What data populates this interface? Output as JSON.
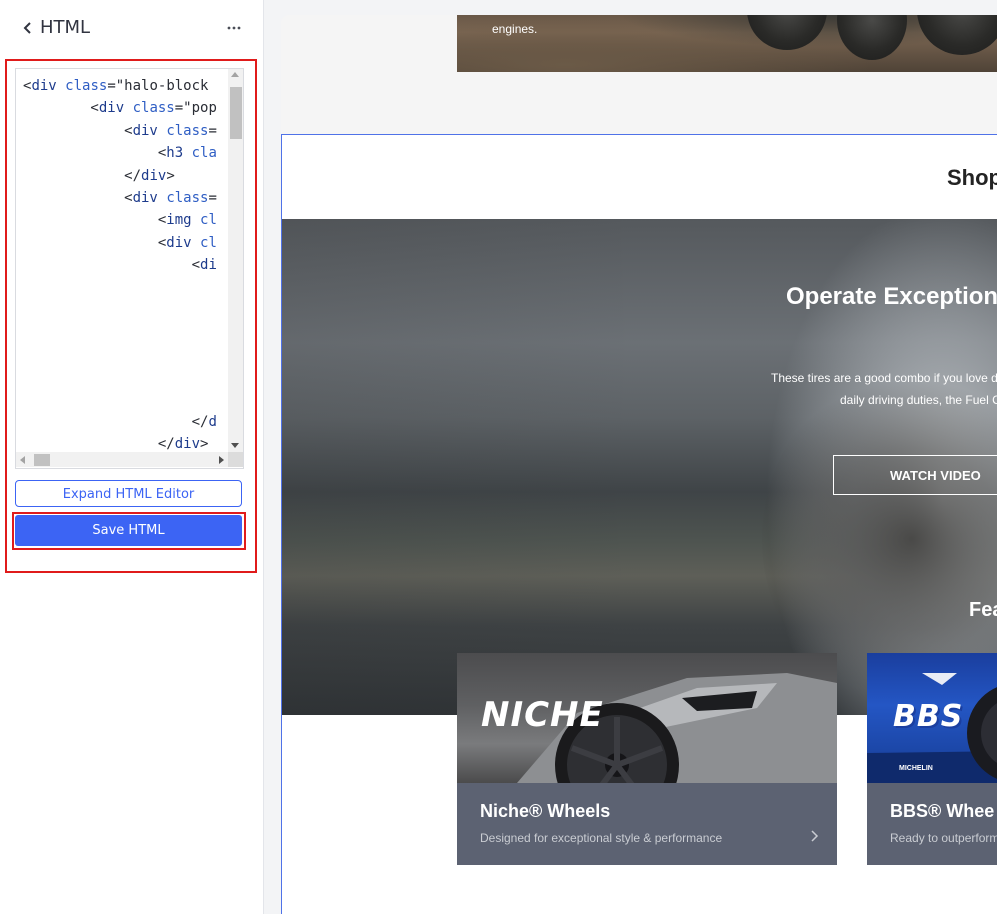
{
  "sidebar": {
    "title": "HTML",
    "code_lines": [
      "<div class=\"halo-block",
      "        <div class=\"pop",
      "            <div class=",
      "                <h3 cla",
      "            </div>",
      "            <div class=",
      "                <img cl",
      "                <div cl",
      "                    <di",
      "",
      "",
      "",
      "",
      "",
      "",
      "                    </d",
      "                </div>"
    ],
    "expand_label": "Expand HTML Editor",
    "save_label": "Save HTML"
  },
  "preview": {
    "top_caption": "engines.",
    "shop_heading": "Shop",
    "hero": {
      "title": "Operate Exception",
      "text_line1": "These tires are a good combo if you love d",
      "text_line2": "daily driving duties, the Fuel C",
      "button_label": "WATCH VIDEO"
    },
    "featured_heading": "Fea",
    "cards": [
      {
        "logo": "NICHE",
        "title": "Niche® Wheels",
        "desc": "Designed for exceptional style & performance"
      },
      {
        "logo": "BBS",
        "badge": "MICHELIN",
        "title": "BBS® Whee",
        "desc": "Ready to outperform"
      }
    ]
  },
  "colors": {
    "accent": "#3c64f4",
    "highlight_outline": "#e01b1b",
    "card_body": "#5c6272"
  }
}
